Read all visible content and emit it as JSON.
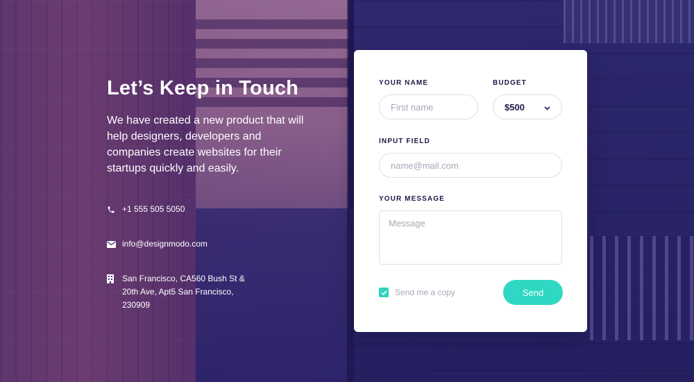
{
  "intro": {
    "title": "Let’s Keep in Touch",
    "description": "We have created a new product that will help designers, developers and companies create websites for their startups quickly and easily."
  },
  "contacts": {
    "phone": "+1 555 505 5050",
    "email": "info@designmodo.com",
    "address": "San Francisco, CA560 Bush St & 20th Ave, Apt5 San Francisco, 230909"
  },
  "form": {
    "name_label": "YOUR NAME",
    "name_placeholder": "First name",
    "budget_label": "BUDGET",
    "budget_value": "$500",
    "input_label": "INPUT FIELD",
    "input_placeholder": "name@mail.com",
    "message_label": "YOUR MESSAGE",
    "message_placeholder": "Message",
    "copy_label": "Send me a copy",
    "copy_checked": true,
    "send_label": "Send"
  },
  "colors": {
    "accent": "#2ed8c3",
    "heading": "#1b1a47",
    "placeholder": "#a7a8b8"
  },
  "icons": {
    "phone": "phone-icon",
    "email": "envelope-icon",
    "address": "building-icon",
    "dropdown": "chevron-down-icon",
    "check": "check-icon"
  }
}
